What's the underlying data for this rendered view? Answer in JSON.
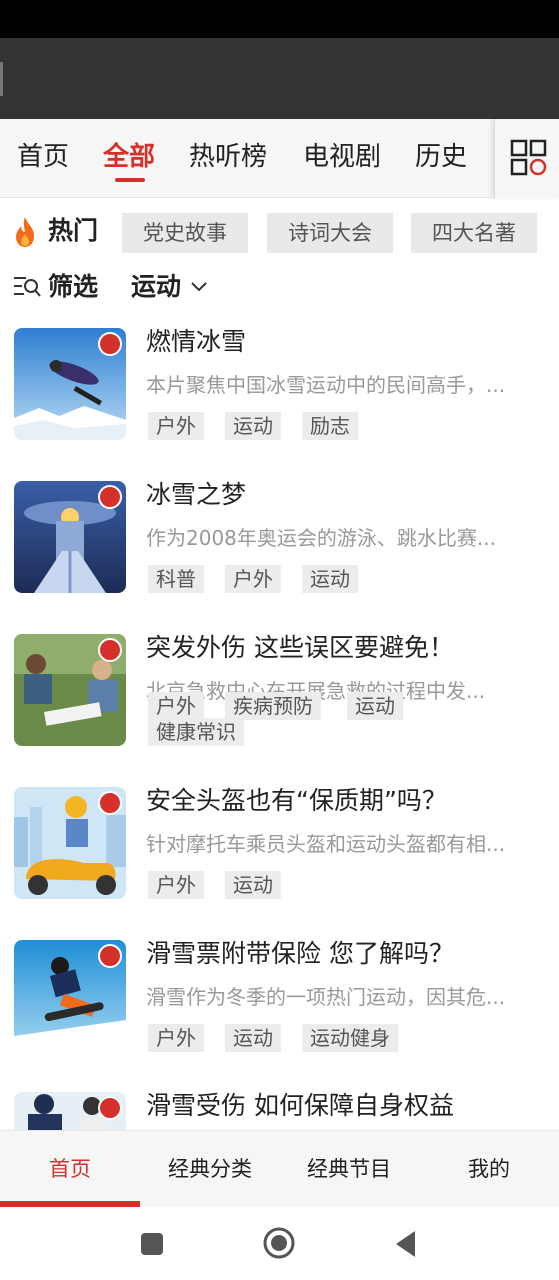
{
  "top_tabs": [
    "首页",
    "全部",
    "热听榜",
    "电视剧",
    "历史"
  ],
  "hot": {
    "label": "热门",
    "chips": [
      "党史故事",
      "诗词大会",
      "四大名著"
    ]
  },
  "filter": {
    "label": "筛选",
    "value": "运动"
  },
  "programs": [
    {
      "title": "燃情冰雪",
      "desc": "本片聚焦中国冰雪运动中的民间高手，...",
      "tags": [
        "户外",
        "运动",
        "励志"
      ]
    },
    {
      "title": "冰雪之梦",
      "desc": "作为2008年奥运会的游泳、跳水比赛...",
      "tags": [
        "科普",
        "户外",
        "运动"
      ]
    },
    {
      "title": "突发外伤 这些误区要避免！",
      "desc": "北京急救中心在开展急救的过程中发...",
      "tags": [
        "户外",
        "疾病预防",
        "运动",
        "健康常识"
      ]
    },
    {
      "title": "安全头盔也有“保质期”吗？",
      "desc": "针对摩托车乘员头盔和运动头盔都有相...",
      "tags": [
        "户外",
        "运动"
      ]
    },
    {
      "title": "滑雪票附带保险 您了解吗？",
      "desc": "滑雪作为冬季的一项热门运动，因其危...",
      "tags": [
        "户外",
        "运动",
        "运动健身"
      ]
    },
    {
      "title": "滑雪受伤 如何保障自身权益",
      "desc": "",
      "tags": []
    }
  ],
  "bottom_nav": [
    "首页",
    "经典分类",
    "经典节目",
    "我的"
  ],
  "colors": {
    "accent": "#d4312c",
    "top_bar": "#333333",
    "tab_bg": "#f6f6f6"
  },
  "icons": [
    "grid-icon",
    "flame-icon",
    "filter-icon",
    "chevron-down-icon",
    "radio-badge-icon",
    "recent-apps-icon",
    "home-circle-icon",
    "back-triangle-icon"
  ]
}
